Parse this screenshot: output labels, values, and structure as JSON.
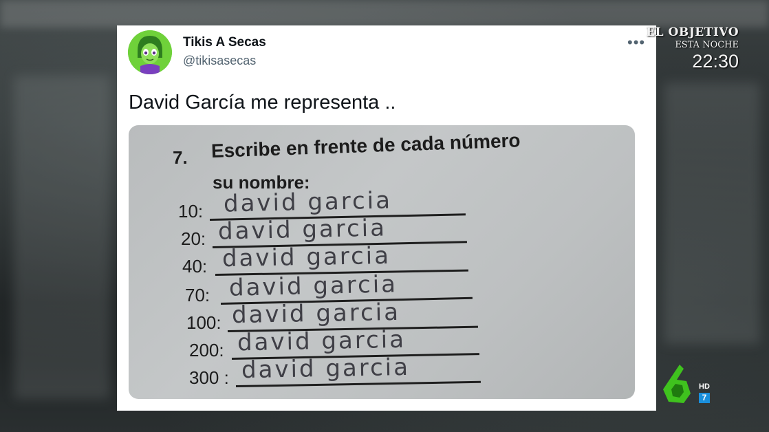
{
  "tweet": {
    "author_name": "Tikis A Secas",
    "author_handle": "@tikisasecas",
    "text": "David García me representa ..",
    "more_label": "•••"
  },
  "worksheet": {
    "question_number": "7.",
    "question_line1": "Escribe en frente de cada número",
    "question_line2": "su nombre:",
    "rows": [
      {
        "label": "10:",
        "answer": "david garcia"
      },
      {
        "label": "20:",
        "answer": "david garcia"
      },
      {
        "label": "40:",
        "answer": "david garcia"
      },
      {
        "label": "70:",
        "answer": "david garcia"
      },
      {
        "label": "100:",
        "answer": "david garcia"
      },
      {
        "label": "200:",
        "answer": "david garcia"
      },
      {
        "label": "300 :",
        "answer": "david garcia"
      }
    ]
  },
  "tv_overlay": {
    "program_line1": "EL OBJETIVO",
    "program_line2": "ESTA NOCHE",
    "time": "22:30",
    "channel_badge": "HD",
    "channel_number": "7"
  },
  "colors": {
    "avatar_green": "#6fd13a",
    "channel_logo_green": "#3fc21e",
    "channel_blue": "#1a8fdc"
  }
}
